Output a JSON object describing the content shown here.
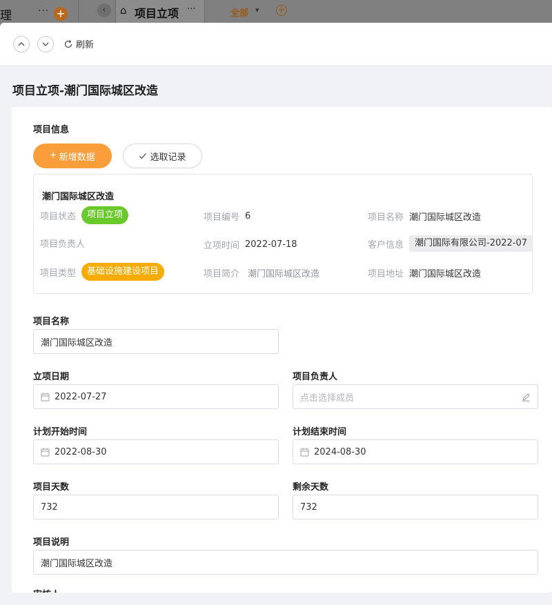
{
  "bg": {
    "left_text": "理",
    "more": "···",
    "tab_title": "项目立项",
    "tab_more": "···",
    "filter": "全部"
  },
  "toolbar": {
    "refresh_label": "刷新"
  },
  "page": {
    "title": "项目立项-潮门国际城区改造"
  },
  "section": {
    "title": "项目信息",
    "add_label": "新增数据",
    "pick_label": "选取记录"
  },
  "record": {
    "name": "潮门国际城区改造",
    "fields": {
      "status_key": "项目状态",
      "status_val": "项目立项",
      "code_key": "项目编号",
      "code_val": "6",
      "pname_key": "项目名称",
      "pname_val": "潮门国际城区改造",
      "owner_key": "项目负责人",
      "owner_val": "",
      "date_key": "立项时间",
      "date_val": "2022-07-18",
      "client_key": "客户信息",
      "client_val": "潮门国际有限公司-2022-07",
      "type_key": "项目类型",
      "type_val": "基础设施建设项目",
      "brief_key": "项目简介",
      "brief_val": "潮门国际城区改造",
      "addr_key": "项目地址",
      "addr_val": "潮门国际城区改造"
    },
    "colors": {
      "status": "#6ac92a",
      "type": "#f6ab05"
    }
  },
  "form": {
    "name_label": "项目名称",
    "name_value": "潮门国际城区改造",
    "date_label": "立项日期",
    "date_value": "2022-07-27",
    "owner_label": "项目负责人",
    "owner_placeholder": "点击选择成员",
    "start_label": "计划开始时间",
    "start_value": "2022-08-30",
    "end_label": "计划结束时间",
    "end_value": "2024-08-30",
    "days_label": "项目天数",
    "days_value": "732",
    "remain_label": "剩余天数",
    "remain_value": "732",
    "desc_label": "项目说明",
    "desc_value": "潮门国际城区改造",
    "next_label": "审核人"
  },
  "colors": {
    "accent": "#fa9d3b"
  }
}
